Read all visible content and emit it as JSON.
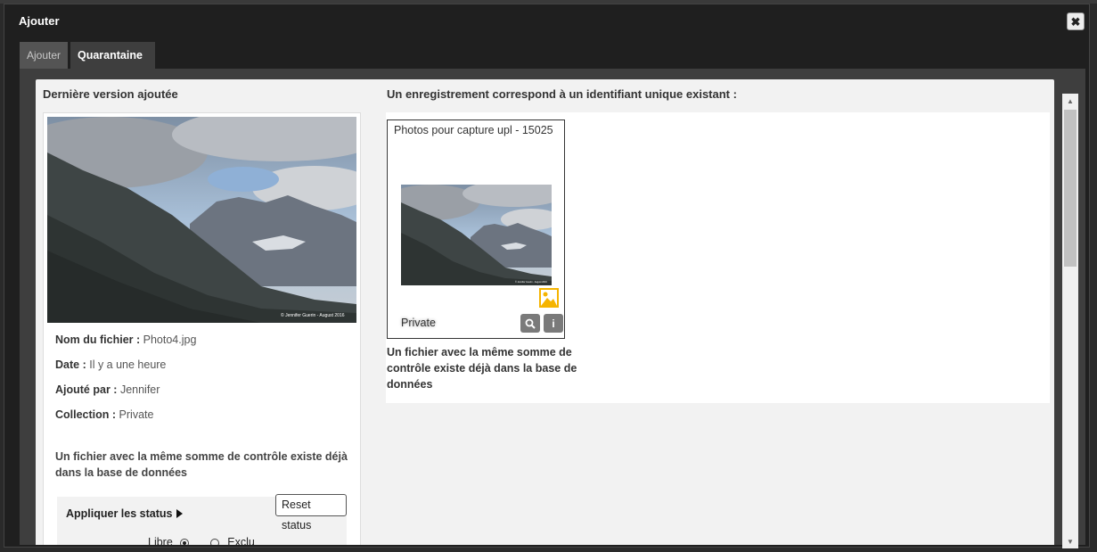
{
  "dialog": {
    "title": "Ajouter",
    "close_icon": "close-x-icon"
  },
  "tabs": [
    {
      "label": "Ajouter",
      "active": false
    },
    {
      "label": "Quarantaine",
      "active": true
    }
  ],
  "left": {
    "title": "Dernière version ajoutée",
    "fields": [
      {
        "label": "Nom du fichier :",
        "value": "Photo4.jpg"
      },
      {
        "label": "Date :",
        "value": "Il y a une heure"
      },
      {
        "label": "Ajouté par :",
        "value": "Jennifer"
      },
      {
        "label": "Collection :",
        "value": "Private"
      }
    ],
    "photo_credit": "© Jennifer Guerin - August 2016",
    "duplicate_message": "Un fichier avec la même somme de contrôle existe déjà dans la base de données",
    "status": {
      "title": "Appliquer les status",
      "reset_label": "Reset status",
      "options": [
        {
          "label": "Libre",
          "selected": true
        },
        {
          "label": "Exclu",
          "selected": false
        }
      ]
    }
  },
  "right": {
    "title": "Un enregistrement correspond à un identifiant unique existant :",
    "record": {
      "title": "Photos pour capture upl - 15025",
      "collection": "Private",
      "type_icon": "image-icon",
      "search_icon": "search-icon",
      "info_icon": "info-icon",
      "photo_credit": "© Jennifer Guerin - August 2016"
    },
    "duplicate_message": "Un fichier avec la même somme de contrôle existe déjà dans la base de données"
  },
  "colors": {
    "dialog_bg": "#1f1f1f",
    "tab_active_bg": "#3e3e3e",
    "tab_inactive_bg": "#545454",
    "panel_bg": "#f2f2f2",
    "image_icon": "#f5b400",
    "action_button_bg": "#7a7a7a"
  }
}
